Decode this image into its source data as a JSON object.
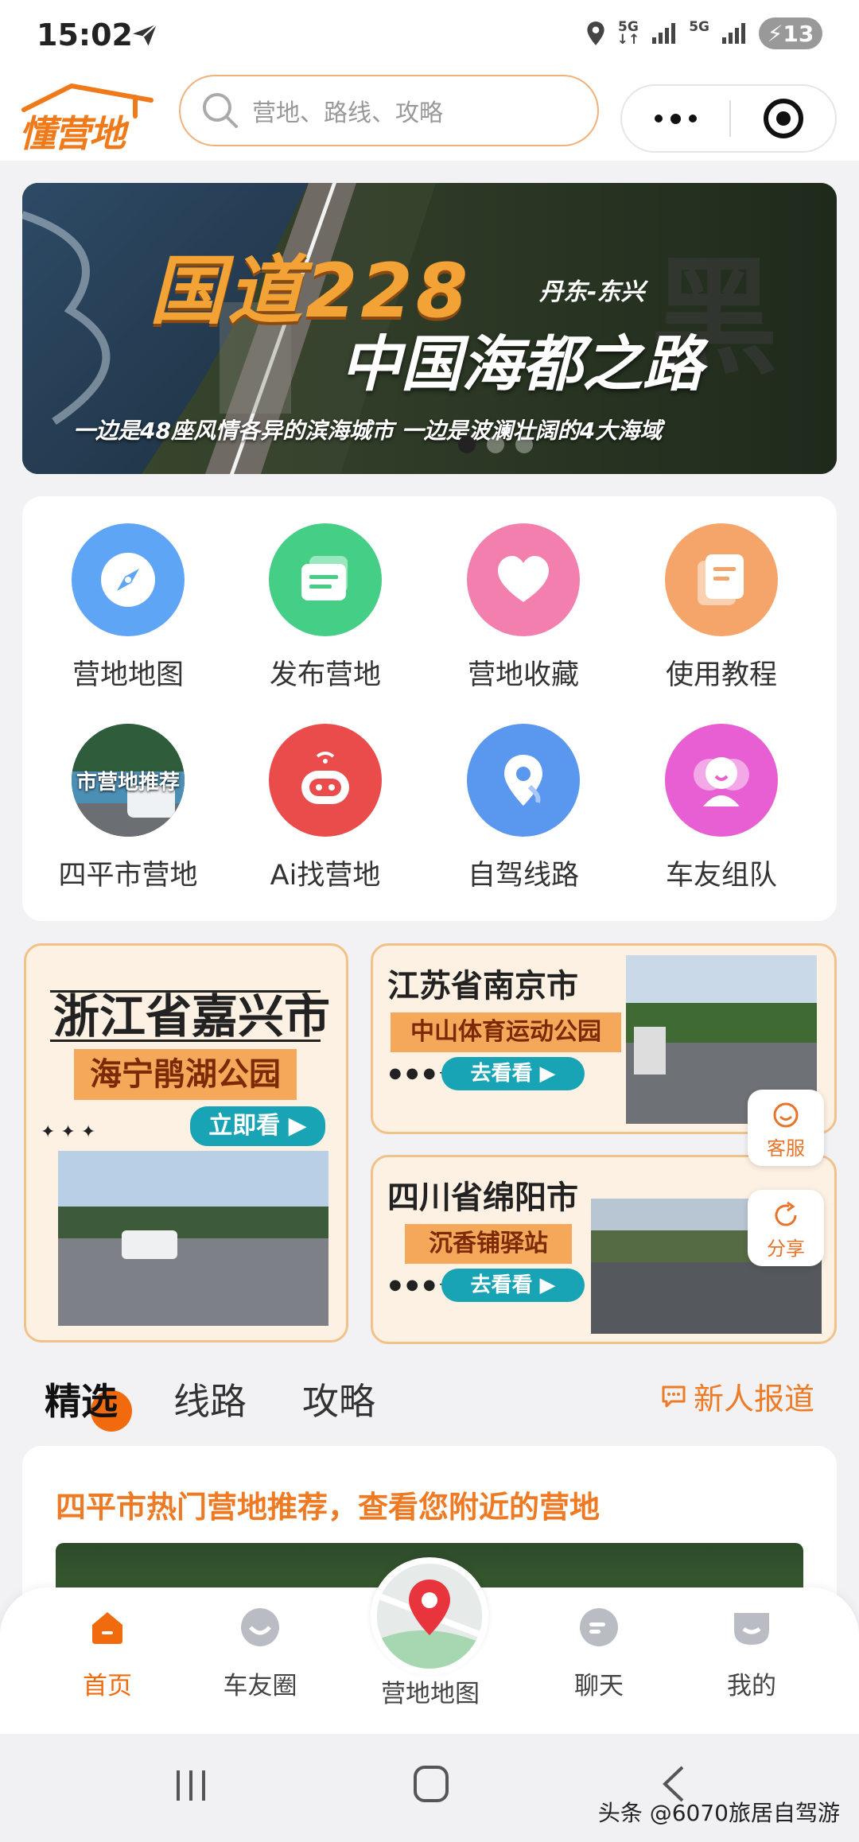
{
  "status_bar": {
    "time": "15:02",
    "network_1": "5G",
    "network_2": "5G",
    "battery": "13"
  },
  "header": {
    "logo_text": "懂营地",
    "search_placeholder": "营地、路线、攻略"
  },
  "banner": {
    "title": "国道228",
    "route": "丹东-东兴",
    "subtitle": "中国海都之路",
    "big_char": "黑",
    "caption": "一边是48座风情各异的滨海城市 一边是波澜壮阔的4大海域",
    "active_index": 0,
    "dot_count": 3
  },
  "menu": {
    "items": [
      {
        "label": "营地地图",
        "icon": "compass-icon",
        "color": "#5ea6f5"
      },
      {
        "label": "发布营地",
        "icon": "publish-card-icon",
        "color": "#45cf86"
      },
      {
        "label": "营地收藏",
        "icon": "heart-icon",
        "color": "#f27fae"
      },
      {
        "label": "使用教程",
        "icon": "document-icon",
        "color": "#f6a56a"
      },
      {
        "label": "四平市营地",
        "icon": "city-camp-photo",
        "overlay": "市营地推荐"
      },
      {
        "label": "Ai找营地",
        "icon": "robot-icon",
        "color": "#ea4b4b"
      },
      {
        "label": "自驾线路",
        "icon": "map-pin-icon",
        "color": "#5a97ef"
      },
      {
        "label": "车友组队",
        "icon": "people-icon",
        "color": "#e85ed3"
      }
    ]
  },
  "promos": {
    "left": {
      "city": "浙江省嘉兴市",
      "place": "海宁鹃湖公园",
      "button": "立即看"
    },
    "right_top": {
      "city": "江苏省南京市",
      "place": "中山体育运动公园",
      "button": "去看看"
    },
    "right_bottom": {
      "city": "四川省绵阳市",
      "place": "沉香铺驿站",
      "button": "去看看"
    }
  },
  "floating": {
    "service": "客服",
    "share": "分享"
  },
  "tabs": {
    "items": [
      "精选",
      "线路",
      "攻略"
    ],
    "active": "精选",
    "news_link": "新人报道"
  },
  "feed": {
    "title": "四平市热门营地推荐，查看您附近的营地"
  },
  "tabbar": {
    "items": [
      {
        "label": "首页",
        "icon": "home-icon"
      },
      {
        "label": "车友圈",
        "icon": "moments-icon"
      },
      {
        "label": "营地地图",
        "icon": "map-location-icon"
      },
      {
        "label": "聊天",
        "icon": "chat-icon"
      },
      {
        "label": "我的",
        "icon": "profile-icon"
      }
    ],
    "active": "首页",
    "accent_color": "#f26a0e"
  },
  "watermark": "头条 @6070旅居自驾游"
}
